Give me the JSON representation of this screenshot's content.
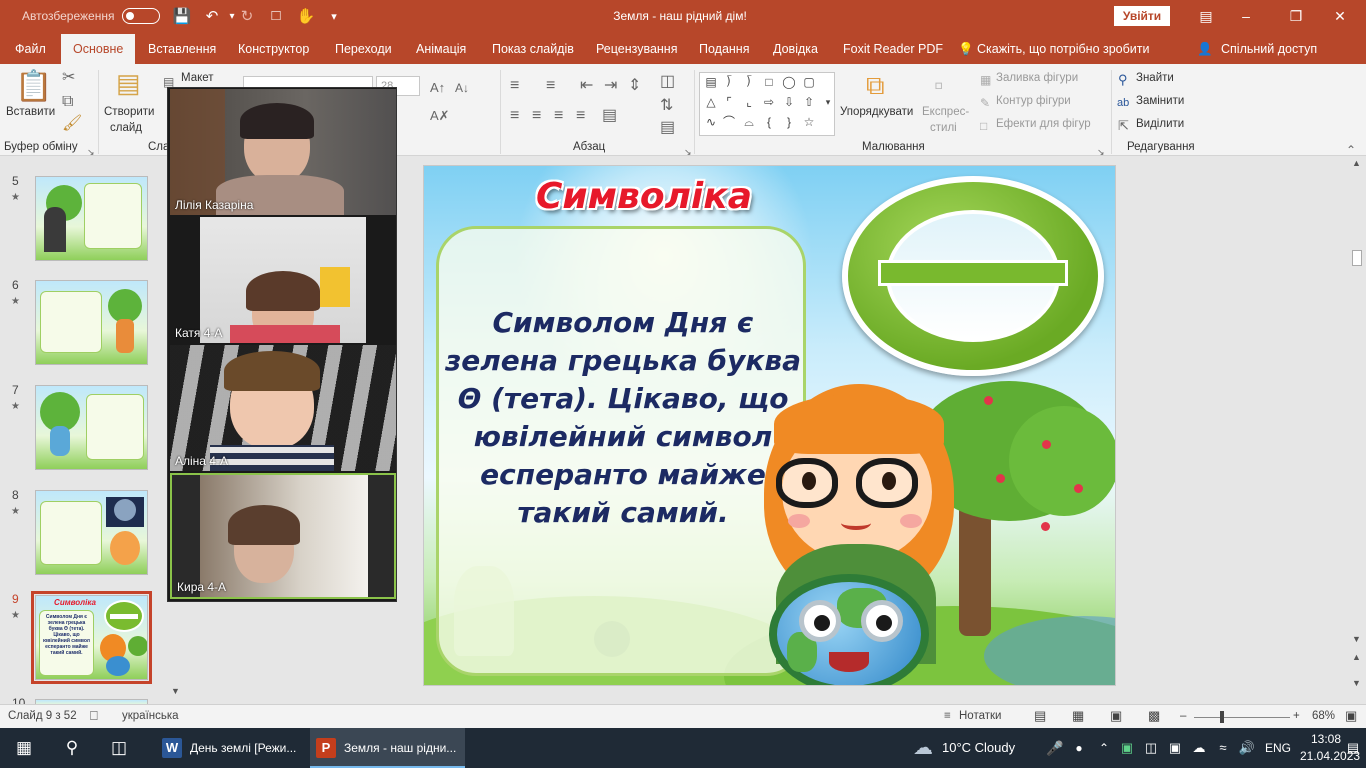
{
  "titlebar": {
    "autosave_label": "Автозбереження",
    "title": "Земля - наш рідний дім!",
    "signin_label": "Увійти",
    "qa_icons": [
      "save-icon",
      "undo-icon",
      "redo-icon",
      "present-from-start-icon",
      "touch-mode-icon",
      "customize-quick-access-icon"
    ]
  },
  "menu": {
    "tabs": [
      {
        "label": "Файл"
      },
      {
        "label": "Основне"
      },
      {
        "label": "Вставлення"
      },
      {
        "label": "Конструктор"
      },
      {
        "label": "Переходи"
      },
      {
        "label": "Анімація"
      },
      {
        "label": "Показ слайдів"
      },
      {
        "label": "Рецензування"
      },
      {
        "label": "Подання"
      },
      {
        "label": "Довідка"
      },
      {
        "label": "Foxit Reader PDF"
      }
    ],
    "active_tab": "Основне",
    "tell_me": "Скажіть, що потрібно зробити",
    "share": "Спільний доступ"
  },
  "ribbon": {
    "paste": "Вставити",
    "clipboard_group": "Буфер обміну",
    "new_slide_line1": "Створити",
    "new_slide_line2": "слайд",
    "layout": "Макет",
    "slides_group": "Сла",
    "font_size": "28",
    "paragraph_group": "Абзац",
    "arrange": "Упорядкувати",
    "quick_styles_line1": "Експрес-",
    "quick_styles_line2": "стилі",
    "shape_fill": "Заливка фігури",
    "shape_outline": "Контур фігури",
    "shape_effects": "Ефекти для фігур",
    "drawing_group": "Малювання",
    "find": "Знайти",
    "replace": "Замінити",
    "select": "Виділити",
    "editing_group": "Редагування"
  },
  "slides": [
    {
      "num": "5",
      "star": "★"
    },
    {
      "num": "6",
      "star": "★"
    },
    {
      "num": "7",
      "star": "★"
    },
    {
      "num": "8",
      "star": "★"
    },
    {
      "num": "9",
      "star": "★"
    },
    {
      "num": "10",
      "star": ""
    }
  ],
  "current_slide": {
    "title": "Символіка",
    "body": "Символом Дня є зелена грецька буква Θ (тета). Цікаво, що ювілейний символ есперанто майже такий самий.",
    "thumb_title": "Символіка",
    "thumb_body": "Символом Дня є зелена грецька буква Θ (тета). Цікаво, що ювілейний символ есперанто майже такий самий."
  },
  "video_participants": [
    {
      "name": "Лілія Казаріна"
    },
    {
      "name": "Катя  4-А"
    },
    {
      "name": "Аліна 4-А"
    },
    {
      "name": "Кира 4-А"
    }
  ],
  "statusbar": {
    "slide_counter": "Слайд 9 з 52",
    "language": "українська",
    "notes": "Нотатки",
    "zoom": "68%"
  },
  "taskbar": {
    "apps": [
      {
        "label": "День землі [Режи...",
        "icon": "W",
        "color": "#2b5797"
      },
      {
        "label": "Земля - наш рідни...",
        "icon": "P",
        "color": "#c43e1c"
      }
    ],
    "weather": "10°C  Cloudy",
    "language": "ENG",
    "time": "13:08",
    "date": "21.04.2023"
  },
  "colors": {
    "accent": "#b7472a",
    "slide_title": "#e7192a",
    "slide_text": "#1c2a63",
    "theta": "#79b92e"
  }
}
